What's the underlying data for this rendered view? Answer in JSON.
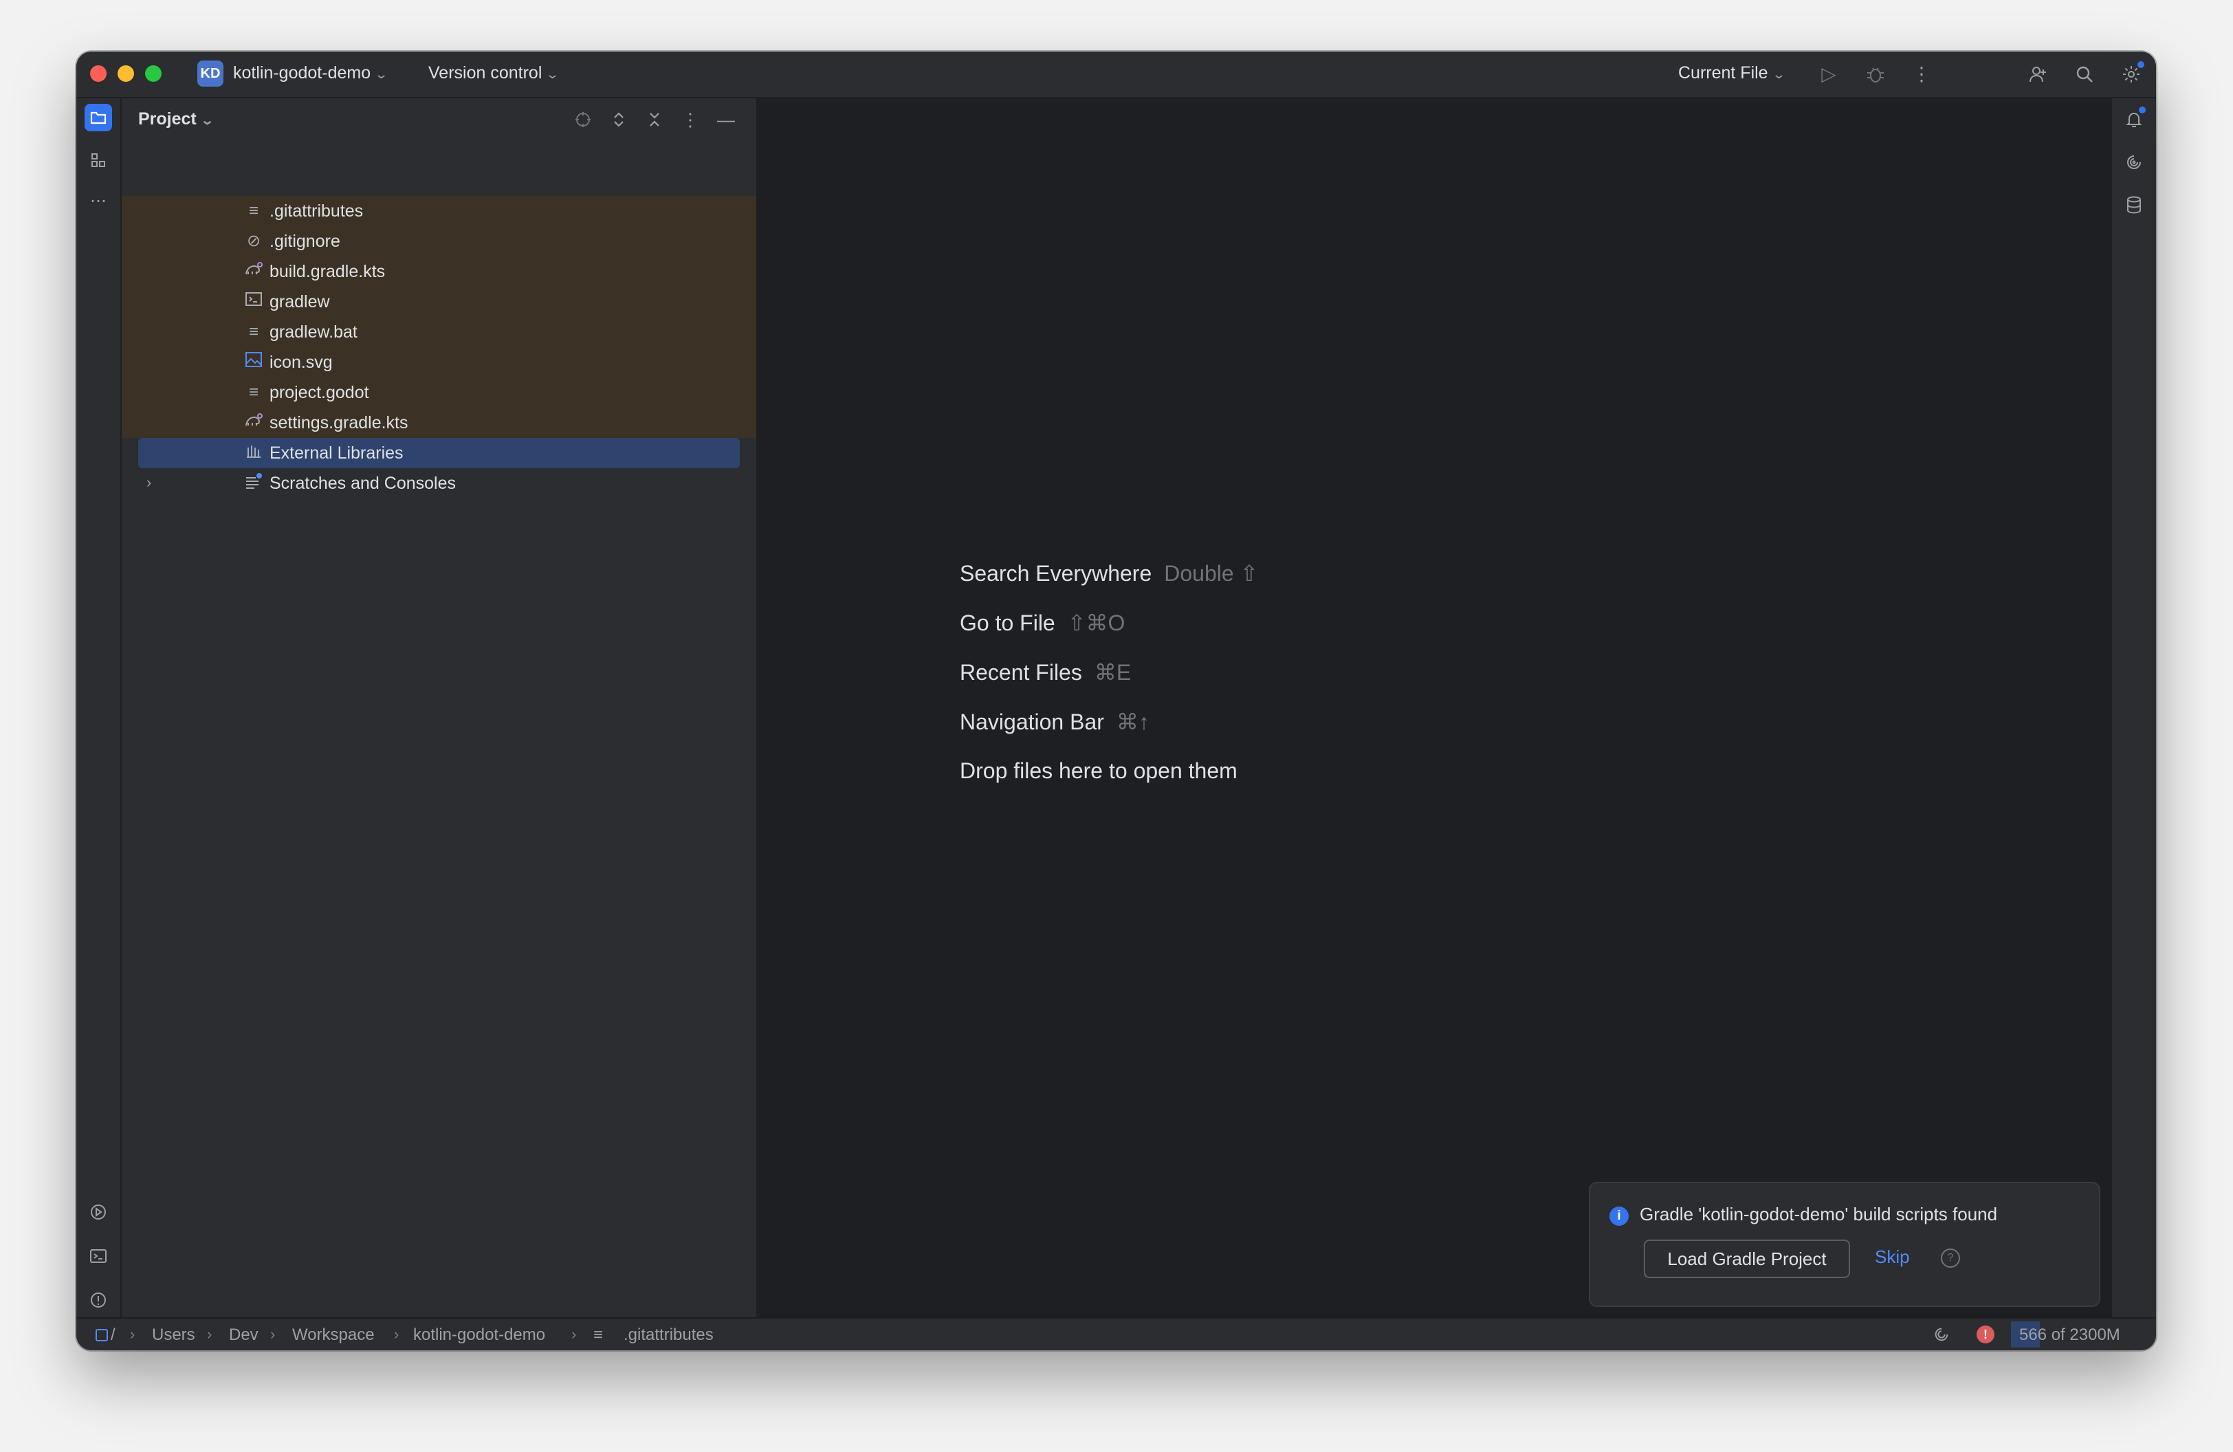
{
  "titlebar": {
    "project_badge": "KD",
    "project_name": "kotlin-godot-demo",
    "vcs_label": "Version control",
    "run_config": "Current File",
    "icons": [
      "play-icon",
      "debug-bug-icon",
      "more-vertical-icon",
      "add-user-icon",
      "search-icon",
      "settings-gear-icon"
    ]
  },
  "left_strip": {
    "icons": [
      "project-folder-icon",
      "structure-icon",
      "more-tools-icon",
      "services-icon",
      "terminal-icon",
      "problems-icon",
      "git-icon"
    ]
  },
  "project_panel": {
    "title": "Project",
    "icons": [
      "locate-icon",
      "expand-all-icon",
      "collapse-all-icon",
      "options-icon",
      "hide-panel-icon"
    ],
    "tree": [
      {
        "label": ".gitattributes",
        "icon": "text-file-icon"
      },
      {
        "label": ".gitignore",
        "icon": "ignore-file-icon"
      },
      {
        "label": "build.gradle.kts",
        "icon": "gradle-file-icon"
      },
      {
        "label": "gradlew",
        "icon": "shell-script-icon"
      },
      {
        "label": "gradlew.bat",
        "icon": "text-file-icon"
      },
      {
        "label": "icon.svg",
        "icon": "image-file-icon"
      },
      {
        "label": "project.godot",
        "icon": "text-file-icon"
      },
      {
        "label": "settings.gradle.kts",
        "icon": "gradle-file-icon"
      },
      {
        "label": "External Libraries",
        "icon": "library-icon"
      },
      {
        "label": "Scratches and Consoles",
        "icon": "scratches-icon"
      }
    ]
  },
  "editor_hints": [
    {
      "label": "Search Everywhere",
      "shortcut": "Double ⇧"
    },
    {
      "label": "Go to File",
      "shortcut": "⇧⌘O"
    },
    {
      "label": "Recent Files",
      "shortcut": "⌘E"
    },
    {
      "label": "Navigation Bar",
      "shortcut": "⌘↑"
    },
    {
      "label": "Drop files here to open them",
      "shortcut": ""
    }
  ],
  "right_strip": {
    "icons": [
      "notifications-icon",
      "ai-assistant-icon",
      "database-icon"
    ]
  },
  "notification": {
    "message": "Gradle 'kotlin-godot-demo' build scripts found",
    "primary_button": "Load Gradle Project",
    "link": "Skip",
    "help": "?"
  },
  "statusbar": {
    "breadcrumbs": [
      "/",
      "Users",
      "Dev",
      "Workspace",
      "kotlin-godot-demo",
      ".gitattributes"
    ],
    "memory": "566 of 2300M",
    "memory_used_fraction": 0.246,
    "error_glyph": "!"
  },
  "colors": {
    "accent": "#3574f0",
    "tint_modified": "#3b3225",
    "selection": "#2e436e",
    "error": "#db5c5c"
  }
}
